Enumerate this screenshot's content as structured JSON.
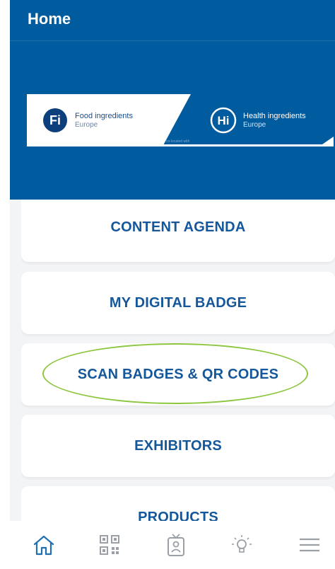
{
  "header": {
    "title": "Home"
  },
  "banner": {
    "fi_logo_text": "Fi",
    "fi_name": "Food ingredients",
    "fi_sub": "Europe",
    "hi_logo_text": "Hi",
    "hi_name": "Health ingredients",
    "hi_sub": "Europe",
    "colocated": "co-located with"
  },
  "menu": {
    "items": [
      {
        "label": "CONTENT AGENDA"
      },
      {
        "label": "MY DIGITAL BADGE"
      },
      {
        "label": "SCAN BADGES & QR CODES",
        "highlighted": true
      },
      {
        "label": "EXHIBITORS"
      },
      {
        "label": "PRODUCTS"
      }
    ]
  },
  "bottom_nav": {
    "items": [
      {
        "icon": "home-icon",
        "active": true
      },
      {
        "icon": "qr-code-icon"
      },
      {
        "icon": "badge-icon"
      },
      {
        "icon": "lightbulb-icon"
      },
      {
        "icon": "hamburger-menu-icon"
      }
    ]
  },
  "colors": {
    "header_bg": "#005b9f",
    "accent_text": "#14579a",
    "highlight_ring": "#8dc63f",
    "nav_active": "#1f6fb2",
    "nav_inactive": "#9aa0a6"
  }
}
